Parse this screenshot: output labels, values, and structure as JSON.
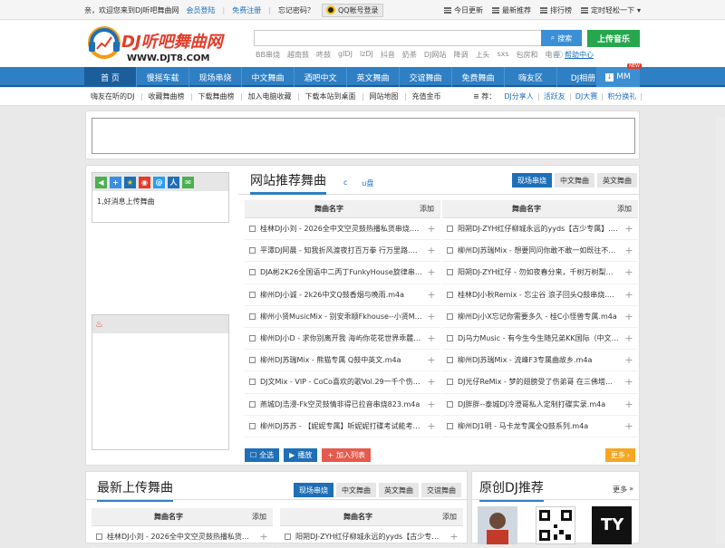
{
  "topbar": {
    "welcome": "亲，欢迎您来到DJ听吧舞曲网",
    "login": "会员登陆",
    "register": "免费注册",
    "forgot": "忘记密码？",
    "qq_login": "QQ帐号登录",
    "today": "今日更新",
    "latest": "最新推荐",
    "rank": "排行榜",
    "timer": "定时轻松一下"
  },
  "header": {
    "logo_text": "DJ听吧舞曲网",
    "logo_url": "WWW.DJT8.COM",
    "search_placeholder": "",
    "search_button": "搜索",
    "upload_button": "上传音乐",
    "hot_words": [
      "BB串烧",
      "越南鼓",
      "咚鼓",
      "gIDJ",
      "lzDJ",
      "抖音",
      "奶茶",
      "DJ网站",
      "降调",
      "上头",
      "sxs",
      "包房和",
      "电音"
    ],
    "help": "帮助中心"
  },
  "nav": {
    "items": [
      "首 页",
      "慢摇车载",
      "现场串烧",
      "中文舞曲",
      "酒吧中文",
      "英文舞曲",
      "交谊舞曲",
      "免费舞曲",
      "嗨友区",
      "DJ相册"
    ],
    "mm_label": "MM",
    "new_badge": "NEW"
  },
  "subnav": {
    "left": [
      "嗨友在听的DJ",
      "收藏舞曲榜",
      "下载舞曲榜",
      "加入电脑收藏",
      "下载本站到桌面",
      "网站地图",
      "充值金币"
    ],
    "rec_label": "荐：",
    "right": [
      "DJ分享人",
      "活跃友",
      "DJ大赛",
      "积分换礼"
    ]
  },
  "sidebar": {
    "notice": "1,好消息上传舞曲"
  },
  "recommend": {
    "title": "网站推荐舞曲",
    "links": [
      "c",
      "u盘"
    ],
    "tabs": [
      "现场串烧",
      "中文舞曲",
      "英文舞曲"
    ],
    "col_name": "舞曲名字",
    "col_add": "添加",
    "left_rows": [
      "桂林DJ小刘 - 2026全中文空灵鼓热播私货串烧.m4a",
      "平潭DJ阿晨 - 知我折风渡夜打百万拳 行万里路.m4a",
      "DJA彬2K26全国语中二丙丁FunkyHouse旋律串烧.m4a",
      "柳州DJ小诚 - 2k26中文Q鼓香烟与晚雨.m4a",
      "柳州小贤MusicMix - 别安乖顺Fkhouse--小贤Music.m4a",
      "柳州DJ小D - 求你别离开我 海屿你花花世界乖麓v.m4a",
      "柳州DJ苏瑞Mix - 熊猫专属 Q鼓中英文.m4a",
      "DJ文Mix - VIP - CoCo喜欢的歌Vol.29一千个伤心.m4a",
      "燕城DJ浩浸-Fk空灵鼓情非得已拉音串烧823.m4a",
      "柳州DJ苏苏 - 【妮妮专属】听妮妮打碟考试能考1.m4a"
    ],
    "right_rows": [
      "阳朔DJ-ZYH红仔柳城永远的yyds【古少专属】.m4a",
      "柳州DJ苏瑞Mix - 想要同问你敢不敢一如既往不改.m4a",
      "阳朔DJ-ZYH红仔 - 勿如夜春分来，千树万树梨花.m4a",
      "桂林DJ小秋Remix - 忘尘谷 浪子回头Q鼓串烧.m4a",
      "柳州Dj小X忘记你需要多久 - 桂C小怪兽专属.m4a",
      "Dj乌力Music - 有今生今生随兄弟KK国际（中文越.m4a",
      "柳州DJ苏瑞Mix - 流峰F3专属曲故乡.m4a",
      "DJ光仔ReMix - 梦的翅膀受了伤弟哥 在三佛塔一.m4a",
      "DJ胖胖--泰城DJ冷澄哥私人定制打碟实录.m4a",
      "柳州DJ1明 - 马卡龙专属全Q鼓系列.m4a"
    ],
    "btn_all": "全选",
    "btn_play": "播放",
    "btn_add": "加入列表",
    "more": "更多"
  },
  "latest": {
    "title": "最新上传舞曲",
    "tabs": [
      "现场串烧",
      "中文舞曲",
      "英文舞曲",
      "交谊舞曲"
    ],
    "col_name": "舞曲名字",
    "col_add": "添加",
    "left_row": "桂林DJ小刘 - 2026全中文空灵鼓热播私货串烧.m4a",
    "right_row": "阳朔DJ-ZYH红仔柳城永远的yyds【古少专属】.m4a"
  },
  "original": {
    "title": "原创DJ推荐",
    "more": "更多"
  },
  "colors": {
    "nav": "#2f7fc4",
    "link": "#1e6fb8",
    "upload": "#27a74d",
    "more": "#f5a623"
  }
}
